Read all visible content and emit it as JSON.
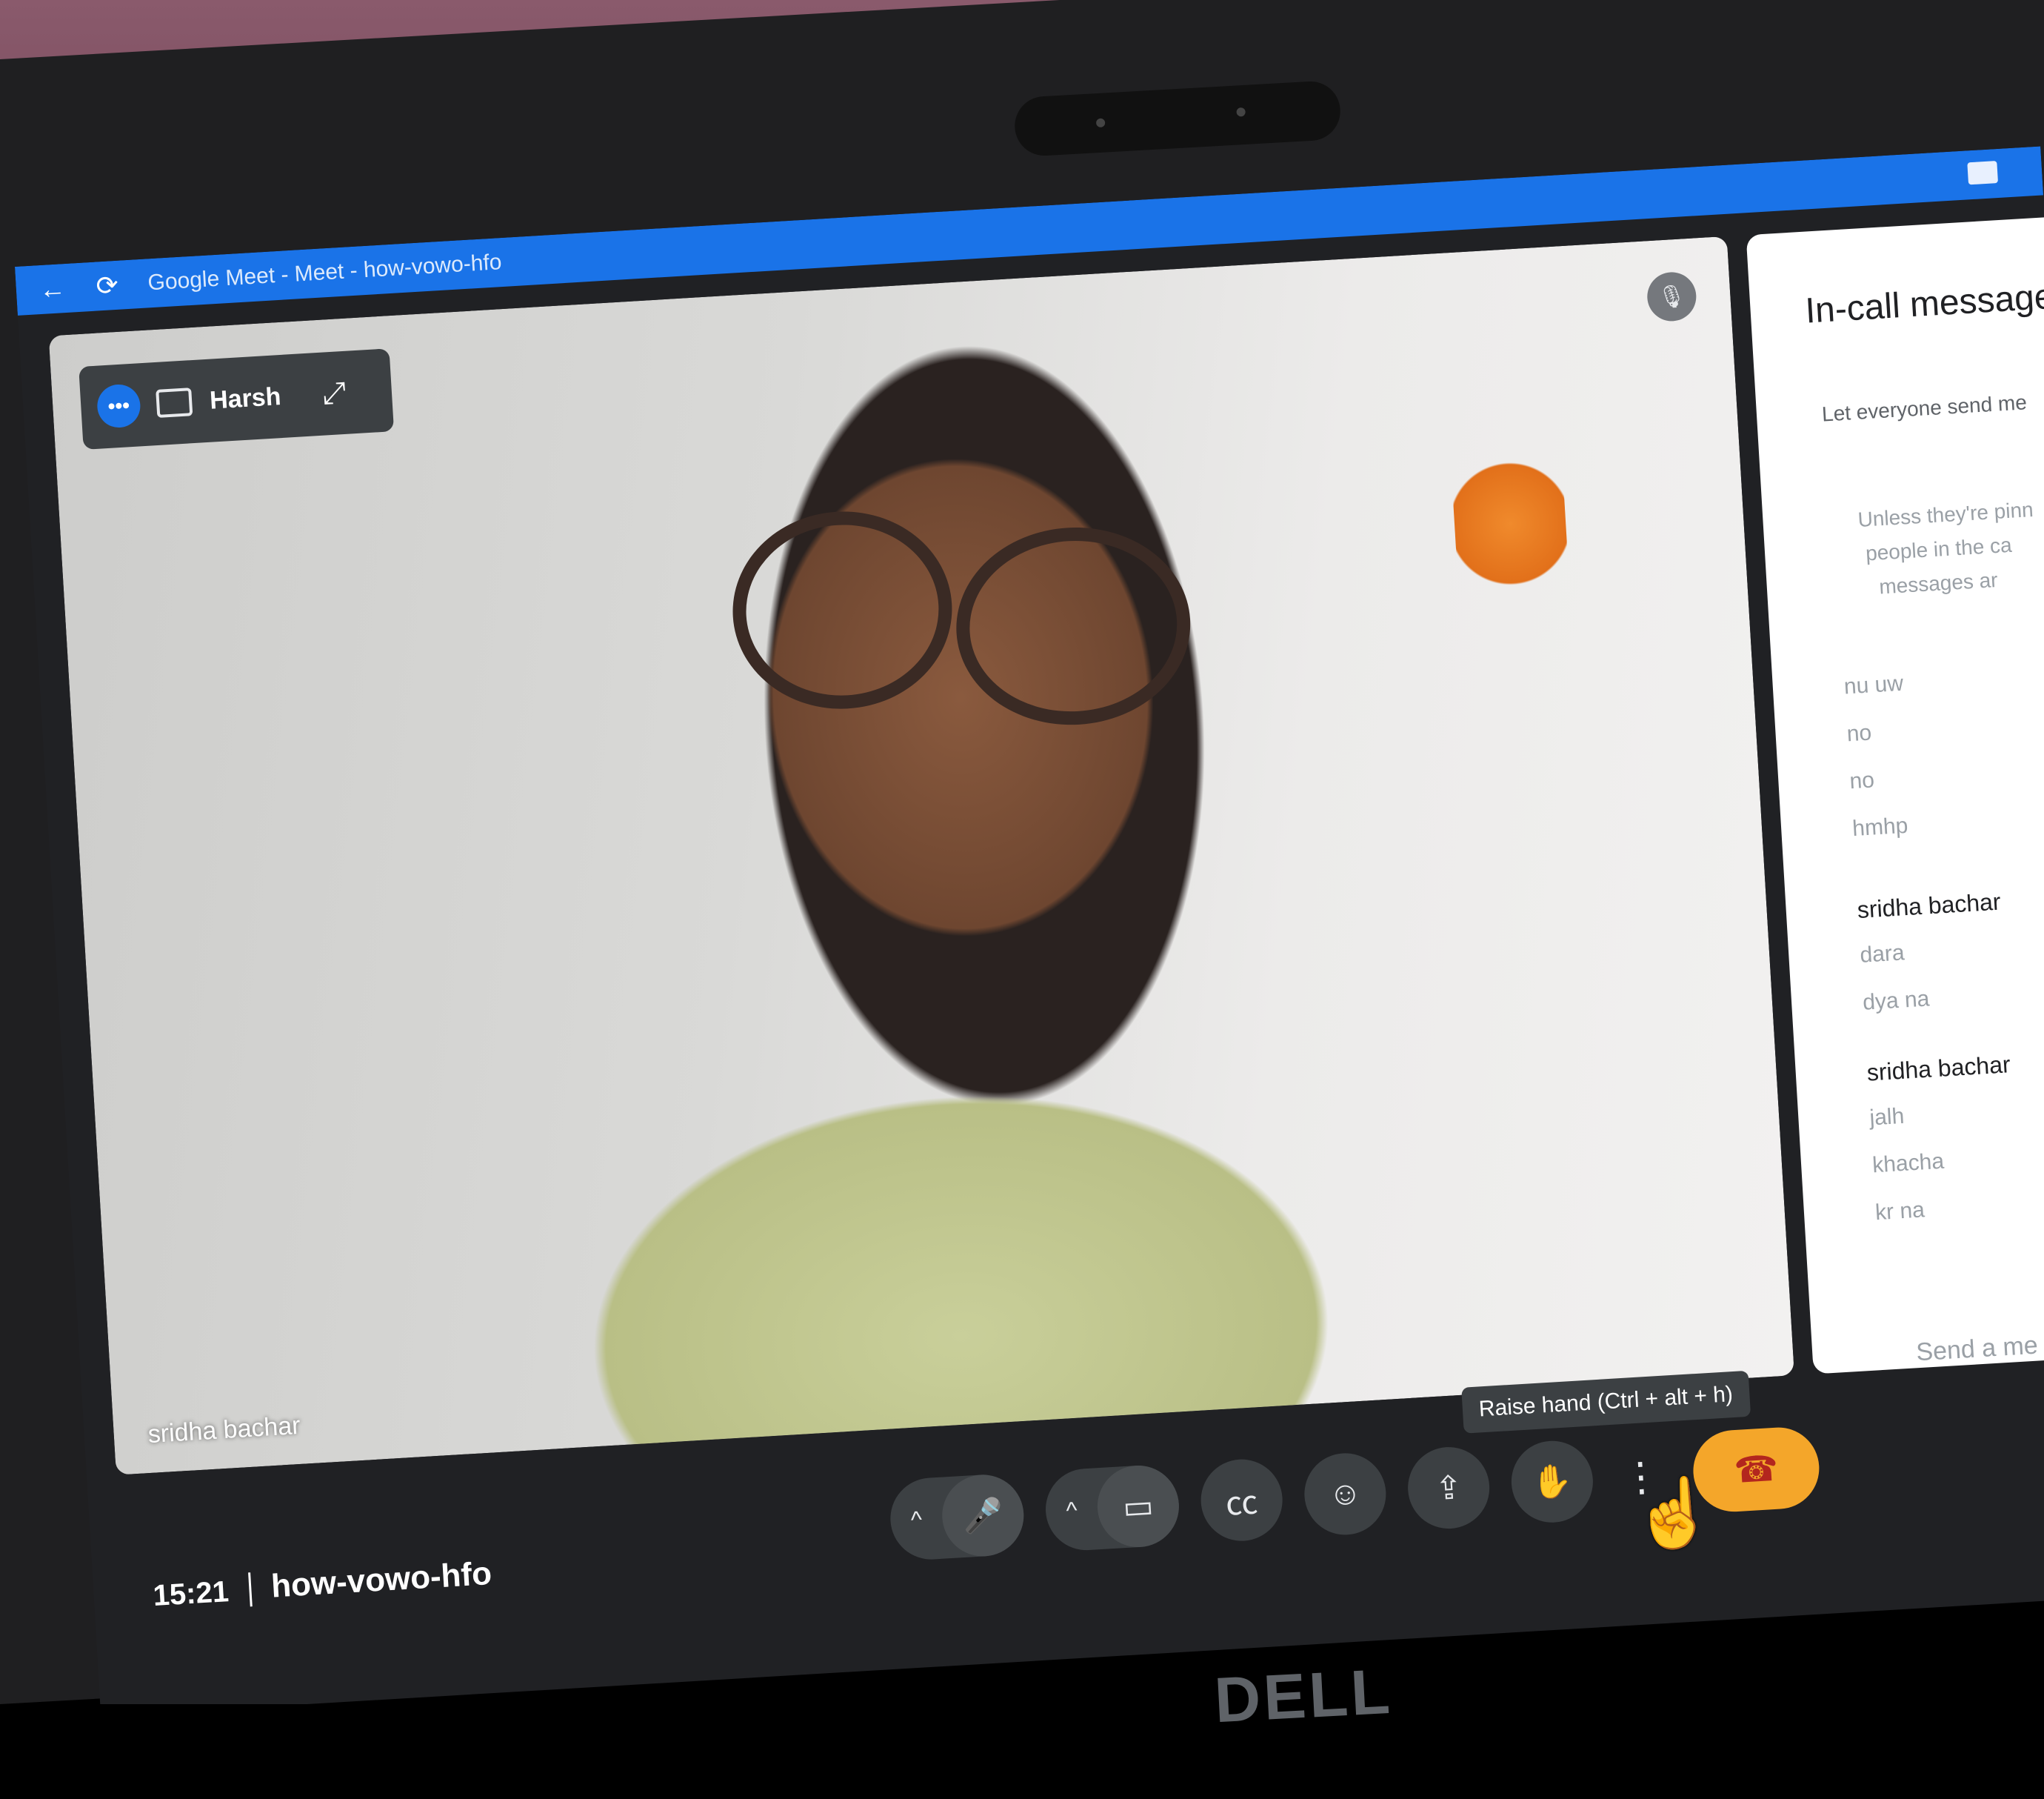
{
  "browser": {
    "title": "Google Meet - Meet - how-vowo-hfo",
    "back_icon": "arrow-left-icon",
    "reload_icon": "reload-icon"
  },
  "video": {
    "pip_name": "Harsh",
    "tile_name": "sridha bachar"
  },
  "chat": {
    "heading": "In-call messages",
    "setting_label": "Let everyone send me",
    "note_lines": "Unless they're pinn\n people in the ca\n   messages ar",
    "messages_before": [
      "nu uw",
      "no",
      "no",
      "hmhp"
    ],
    "groups": [
      {
        "sender": "sridha bachar",
        "messages": [
          "dara",
          "dya na"
        ]
      },
      {
        "sender": "sridha bachar",
        "messages": [
          "jalh",
          "khacha",
          "kr na"
        ]
      }
    ],
    "compose_placeholder": "Send a me"
  },
  "footer": {
    "clock": "15:21",
    "meeting_code": "how-vowo-hfo"
  },
  "controls": {
    "tooltip": "Raise hand (Ctrl + alt + h)",
    "caret": "^",
    "icons": [
      "mic-icon",
      "camera-icon",
      "captions-icon",
      "emoji-icon",
      "present-icon",
      "raise-hand-icon",
      "more-options-icon",
      "leave-call-icon"
    ]
  },
  "hardware": {
    "brand": "DELL"
  },
  "colors": {
    "accent": "#1a73e8",
    "leave": "#f4a62a",
    "toolbar_bg": "#202124",
    "button_bg": "#3c4043"
  }
}
